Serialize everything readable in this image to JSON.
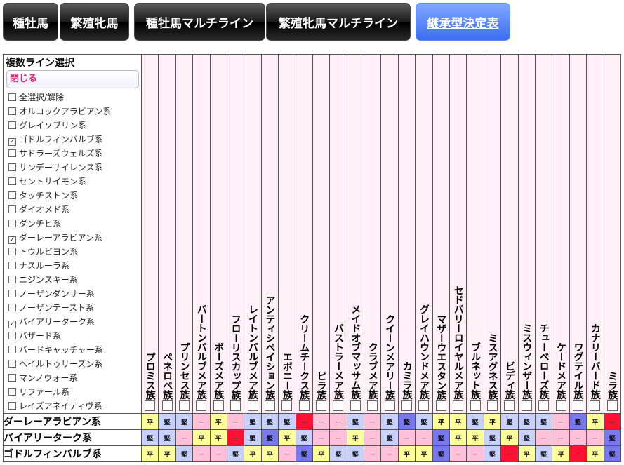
{
  "nav": {
    "tabs": [
      {
        "label": "種牡馬",
        "active": false
      },
      {
        "label": "繁殖牝馬",
        "active": false
      },
      {
        "label": "種牡馬マルチライン",
        "active": false
      },
      {
        "label": "繁殖牝馬マルチライン",
        "active": false
      },
      {
        "label": "継承型決定表",
        "active": true
      }
    ]
  },
  "sidebar": {
    "title": "複数ライン選択",
    "close_label": "閉じる",
    "options": [
      {
        "label": "全選択/解除",
        "checked": false
      },
      {
        "label": "オルコックアラビアン系",
        "checked": false
      },
      {
        "label": "グレイソブリン系",
        "checked": false
      },
      {
        "label": "ゴドルフィンバルブ系",
        "checked": true
      },
      {
        "label": "サドラーズウェルズ系",
        "checked": false
      },
      {
        "label": "サンデーサイレンス系",
        "checked": false
      },
      {
        "label": "セントサイモン系",
        "checked": false
      },
      {
        "label": "タッチストン系",
        "checked": false
      },
      {
        "label": "ダイオメド系",
        "checked": false
      },
      {
        "label": "ダンチヒ系",
        "checked": false
      },
      {
        "label": "ダーレーアラビアン系",
        "checked": true
      },
      {
        "label": "トウルビヨン系",
        "checked": false
      },
      {
        "label": "ナスルーラ系",
        "checked": false
      },
      {
        "label": "ニジンスキー系",
        "checked": false
      },
      {
        "label": "ノーザンダンサー系",
        "checked": false
      },
      {
        "label": "ノーザンテースト系",
        "checked": false
      },
      {
        "label": "バイアリーターク系",
        "checked": true
      },
      {
        "label": "バザード系",
        "checked": false
      },
      {
        "label": "バードキャッチャー系",
        "checked": false
      },
      {
        "label": "ヘイルトゥリーズン系",
        "checked": false
      },
      {
        "label": "マンノウォー系",
        "checked": false
      },
      {
        "label": "リファール系",
        "checked": false
      },
      {
        "label": "レイズアネイティヴ系",
        "checked": false
      }
    ]
  },
  "families": [
    "プロミス族",
    "ペネロペ族",
    "プリンセス族",
    "バートンバルブメア族",
    "ボーズメア族",
    "フローリスカップ族",
    "レイトンバルブメア族",
    "アンティシペイション族",
    "エボニー族",
    "クリームチークス族",
    "ピラ族",
    "バストラーメア族",
    "メイドオブマッサム族",
    "クラブメア族",
    "クイーンメアリー族",
    "カミラ族",
    "グレイハウンドメア族",
    "マザーウエスタン族",
    "セドバリーロイヤルメア族",
    "ブルネット族",
    "ミスアグネス族",
    "ビディ族",
    "ミスウィンザー族",
    "チューベローズ族",
    "ケードメア族",
    "ワグテイル族",
    "カナリーバード族",
    "ミラ族"
  ],
  "rows": [
    {
      "name": "ダーレーアラビアン系",
      "cells": [
        "平",
        "堅",
        "堅",
        "－",
        "平",
        "－",
        "堅",
        "堅",
        "堅",
        "red",
        "－",
        "－",
        "堅",
        "－",
        "堅",
        "堅+",
        "堅",
        "平",
        "平",
        "堅",
        "平",
        "堅",
        "堅",
        "堅",
        "－",
        "堅+",
        "平",
        "red"
      ]
    },
    {
      "name": "バイアリーターク系",
      "cells": [
        "堅",
        "堅",
        "－",
        "平",
        "平",
        "red",
        "堅",
        "堅+",
        "平",
        "堅",
        "－",
        "－",
        "平",
        "－",
        "堅",
        "－",
        "－",
        "堅+",
        "平",
        "平",
        "堅",
        "平",
        "堅",
        "－",
        "－",
        "－",
        "－",
        "堅+"
      ]
    },
    {
      "name": "ゴドルフィンバルブ系",
      "cells": [
        "平",
        "平",
        "堅",
        "－",
        "－",
        "堅",
        "平",
        "平",
        "－",
        "堅+",
        "平",
        "堅",
        "堅",
        "－",
        "－",
        "平",
        "平",
        "堅+",
        "－",
        "－",
        "堅",
        "red",
        "平",
        "堅",
        "平",
        "red",
        "平",
        "堅+"
      ]
    }
  ],
  "legend": {
    "red_mark": "－"
  }
}
